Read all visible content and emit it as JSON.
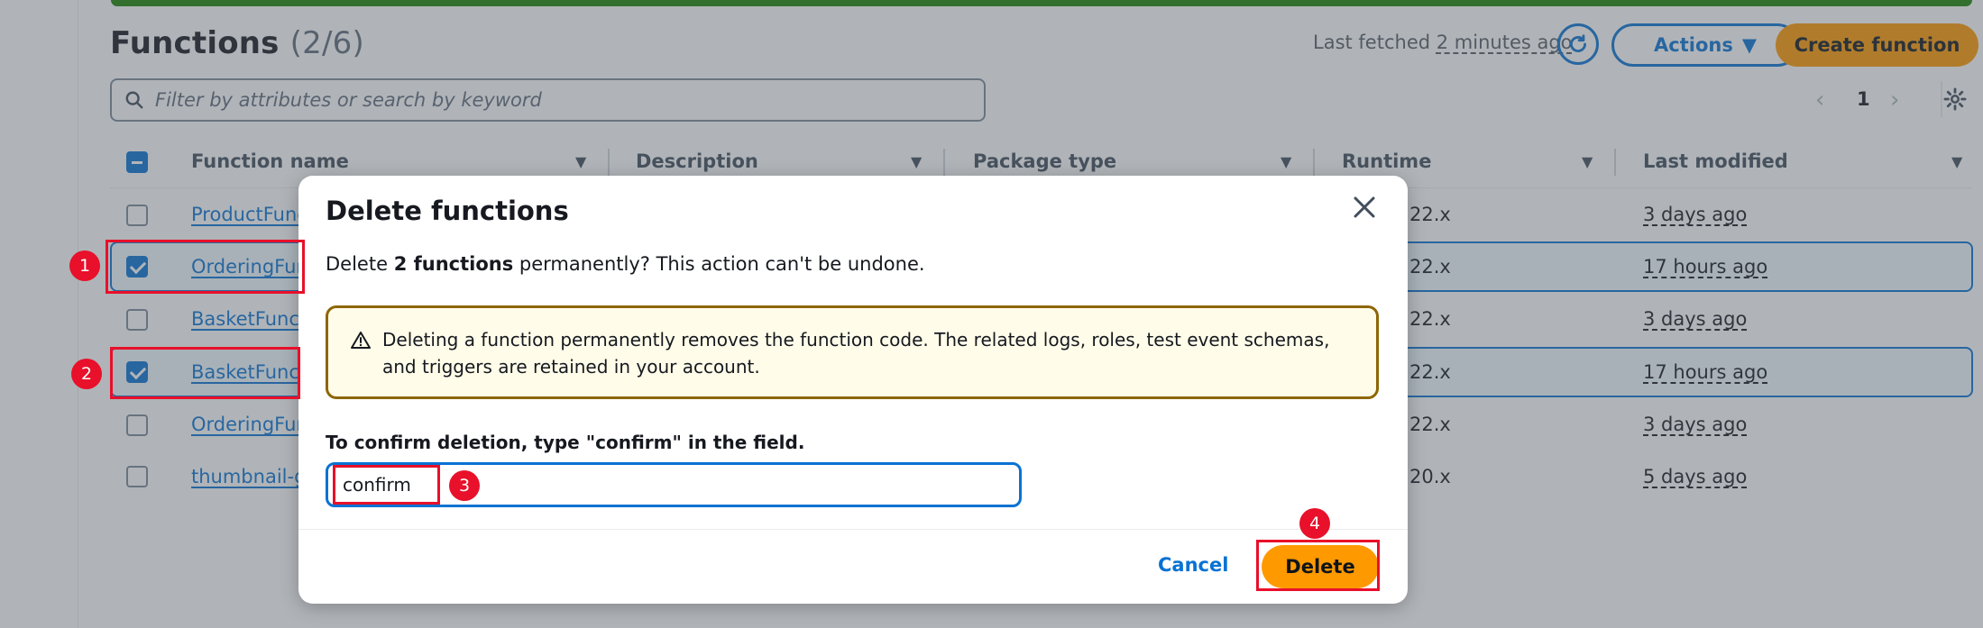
{
  "header": {
    "title": "Functions",
    "count": "(2/6)",
    "last_fetched_prefix": "Last fetched",
    "last_fetched_ago": "2 minutes ago",
    "actions_label": "Actions",
    "create_label": "Create function"
  },
  "filter": {
    "placeholder": "Filter by attributes or search by keyword"
  },
  "pagination": {
    "page": "1"
  },
  "table": {
    "columns": [
      "Function name",
      "Description",
      "Package type",
      "Runtime",
      "Last modified"
    ],
    "rows": [
      {
        "name": "ProductFunc",
        "runtime": "22.x",
        "modified": "3 days ago",
        "selected": false
      },
      {
        "name": "OrderingFun",
        "runtime": "22.x",
        "modified": "17 hours ago",
        "selected": true
      },
      {
        "name": "BasketFuncti",
        "runtime": "22.x",
        "modified": "3 days ago",
        "selected": false
      },
      {
        "name": "BasketFunct",
        "runtime": "22.x",
        "modified": "17 hours ago",
        "selected": true
      },
      {
        "name": "OrderingFun",
        "runtime": "22.x",
        "modified": "3 days ago",
        "selected": false
      },
      {
        "name": "thumbnail-g",
        "runtime": "20.x",
        "modified": "5 days ago",
        "selected": false
      }
    ]
  },
  "modal": {
    "title": "Delete functions",
    "text_prefix": "Delete",
    "text_bold": "2 functions",
    "text_suffix": "permanently? This action can't be undone.",
    "warning": "Deleting a function permanently removes the function code. The related logs, roles, test event schemas, and triggers are retained in your account.",
    "confirm_label": "To confirm deletion, type \"confirm\" in the field.",
    "input_value": "confirm",
    "cancel_label": "Cancel",
    "delete_label": "Delete"
  },
  "annotations": [
    "1",
    "2",
    "3",
    "4"
  ],
  "colors": {
    "accent": "#0972d3",
    "primary_button": "#ff9900",
    "warning_border": "#8d6605",
    "annotation_red": "#e8102a"
  }
}
